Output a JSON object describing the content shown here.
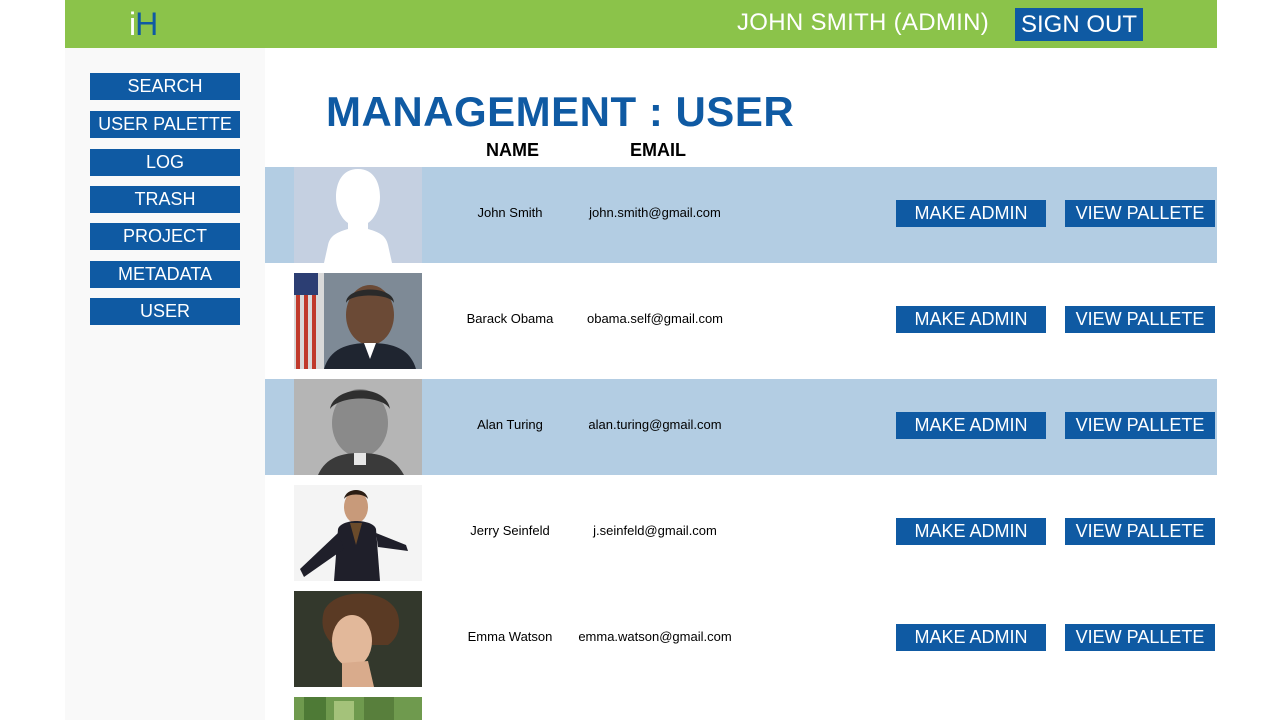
{
  "header": {
    "logo_i": "i",
    "logo_h": "H",
    "user_label": "JOHN SMITH (ADMIN)",
    "signout_label": "SIGN OUT"
  },
  "sidebar": {
    "items": [
      {
        "label": "SEARCH"
      },
      {
        "label": "USER PALETTE"
      },
      {
        "label": "LOG"
      },
      {
        "label": "TRASH"
      },
      {
        "label": "PROJECT"
      },
      {
        "label": "METADATA"
      },
      {
        "label": "USER"
      }
    ]
  },
  "main": {
    "title": "MANAGEMENT : USER",
    "columns": {
      "name": "NAME",
      "email": "EMAIL"
    },
    "users": [
      {
        "name": "John Smith",
        "email": "john.smith@gmail.com",
        "photo": "silhouette-placeholder"
      },
      {
        "name": "Barack Obama",
        "email": "obama.self@gmail.com",
        "photo": "portrait-photo"
      },
      {
        "name": "Alan Turing",
        "email": "alan.turing@gmail.com",
        "photo": "portrait-photo"
      },
      {
        "name": "Jerry Seinfeld",
        "email": "j.seinfeld@gmail.com",
        "photo": "portrait-photo"
      },
      {
        "name": "Emma Watson",
        "email": "emma.watson@gmail.com",
        "photo": "portrait-photo"
      }
    ],
    "actions": {
      "make_admin": "MAKE ADMIN",
      "view_palette": "VIEW PALLETE"
    }
  },
  "colors": {
    "header_green": "#8bc34a",
    "brand_blue": "#0f5aa3",
    "row_highlight": "#b3cde3",
    "sidebar_bg": "#f9f9f9"
  }
}
